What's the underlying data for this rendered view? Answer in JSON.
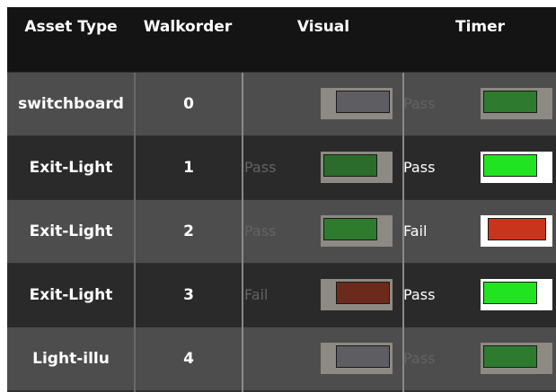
{
  "table": {
    "headers": {
      "asset_type": "Asset Type",
      "walkorder": "Walkorder",
      "visual": "Visual",
      "timer": "Timer"
    },
    "rows": [
      {
        "asset_type": "switchboard",
        "walkorder": "0",
        "visual_status": "",
        "visual_color": "#5e5e62",
        "timer_status": "Pass",
        "timer_color": "#2e7a2e"
      },
      {
        "asset_type": "Exit-Light",
        "walkorder": "1",
        "visual_status": "Pass",
        "visual_color": "#2b6b2b",
        "timer_status": "Pass",
        "timer_color": "#22e322"
      },
      {
        "asset_type": "Exit-Light",
        "walkorder": "2",
        "visual_status": "Pass",
        "visual_color": "#2e7a2e",
        "timer_status": "Fail",
        "timer_color": "#c8351c"
      },
      {
        "asset_type": "Exit-Light",
        "walkorder": "3",
        "visual_status": "Fail",
        "visual_color": "#6b2a1c",
        "timer_status": "Pass",
        "timer_color": "#22e322"
      },
      {
        "asset_type": "Light-illu",
        "walkorder": "4",
        "visual_status": "",
        "visual_color": "#5e5e62",
        "timer_status": "Pass",
        "timer_color": "#2e7a2e"
      }
    ]
  }
}
